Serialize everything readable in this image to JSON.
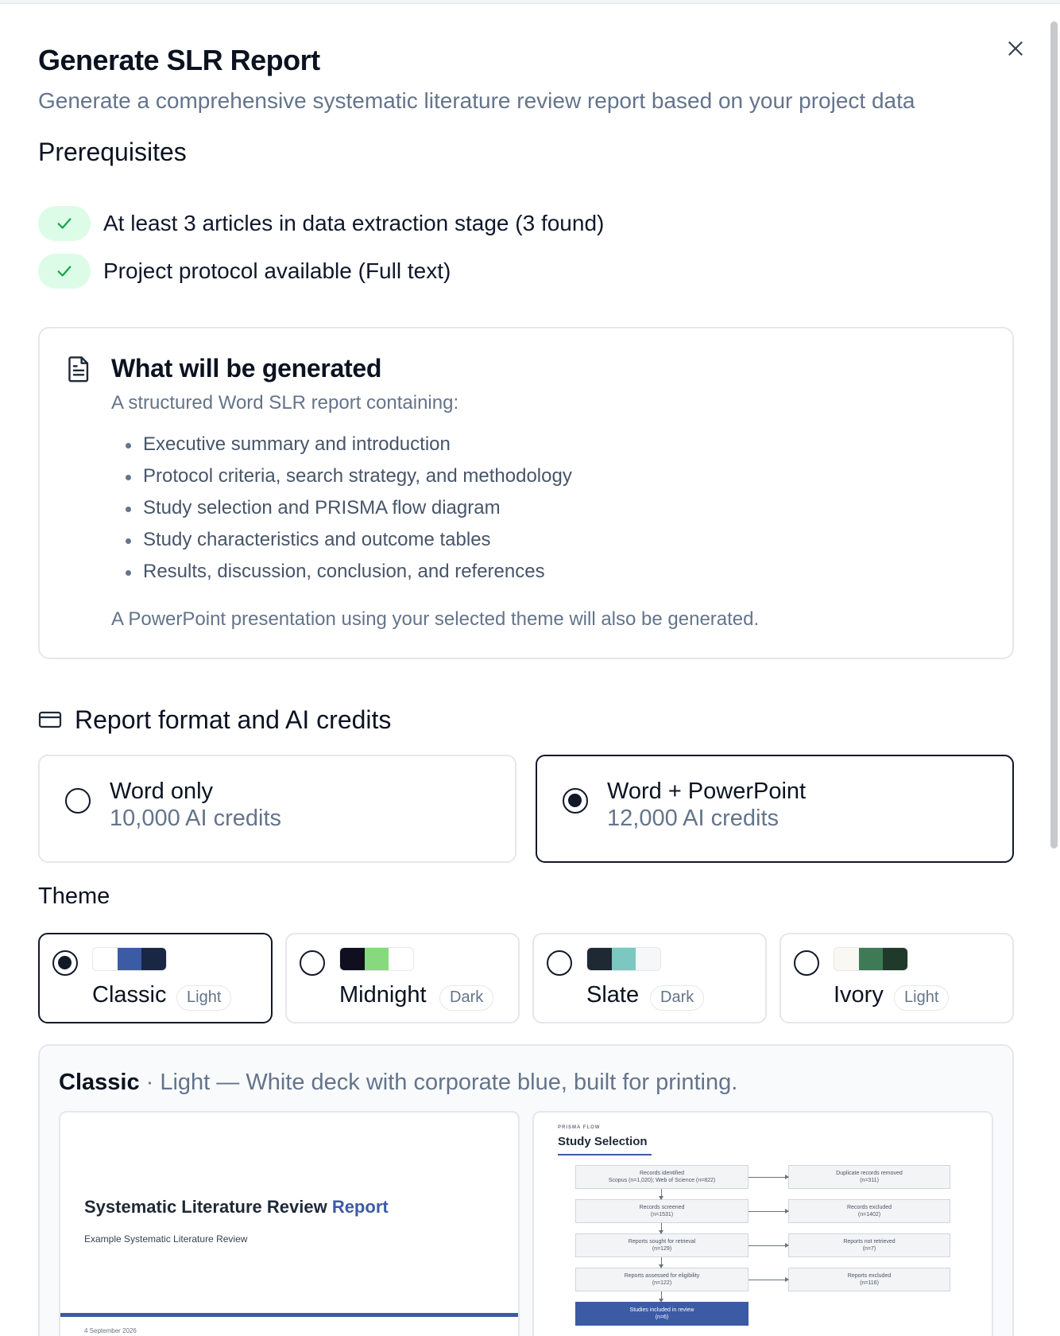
{
  "dialog": {
    "title": "Generate SLR Report",
    "subtitle": "Generate a comprehensive systematic literature review report based on your project data"
  },
  "prerequisites": {
    "heading": "Prerequisites",
    "items": [
      {
        "text": "At least 3 articles in data extraction stage (3 found)",
        "status": "met"
      },
      {
        "text": "Project protocol available (Full text)",
        "status": "met"
      }
    ]
  },
  "generated": {
    "title": "What will be generated",
    "subtitle": "A structured Word SLR report containing:",
    "items": [
      "Executive summary and introduction",
      "Protocol criteria, search strategy, and methodology",
      "Study selection and PRISMA flow diagram",
      "Study characteristics and outcome tables",
      "Results, discussion, conclusion, and references"
    ],
    "footer": "A PowerPoint presentation using your selected theme will also be generated."
  },
  "format": {
    "heading": "Report format and AI credits",
    "options": [
      {
        "name": "Word only",
        "credits": "10,000 AI credits",
        "selected": false
      },
      {
        "name": "Word + PowerPoint",
        "credits": "12,000 AI credits",
        "selected": true
      }
    ]
  },
  "theme": {
    "label": "Theme",
    "options": [
      {
        "name": "Classic",
        "mode": "Light",
        "selected": true,
        "swatch": [
          "#ffffff",
          "#3b5ba5",
          "#1a2744"
        ]
      },
      {
        "name": "Midnight",
        "mode": "Dark",
        "selected": false,
        "swatch": [
          "#0f0f1f",
          "#86d97c",
          "#ffffff"
        ]
      },
      {
        "name": "Slate",
        "mode": "Dark",
        "selected": false,
        "swatch": [
          "#1f2933",
          "#7cc8c1",
          "#f5f7f9"
        ]
      },
      {
        "name": "Ivory",
        "mode": "Light",
        "selected": false,
        "swatch": [
          "#faf8f2",
          "#3e7a55",
          "#1f3a2a"
        ]
      }
    ]
  },
  "preview": {
    "theme_name": "Classic",
    "caption_rest": " · Light — White deck with corporate blue, built for printing.",
    "slide1": {
      "title_main": "Systematic Literature Review ",
      "title_accent": "Report",
      "subtitle": "Example Systematic Literature Review",
      "date": "4 September 2026"
    },
    "slide2": {
      "kicker": "PRISMA FLOW",
      "title": "Study Selection",
      "left_boxes": [
        {
          "l1": "Records identified",
          "l2": "Scopus (n=1,020); Web of Science (n=822)"
        },
        {
          "l1": "Records screened",
          "l2": "(n=1531)"
        },
        {
          "l1": "Reports sought for retrieval",
          "l2": "(n=129)"
        },
        {
          "l1": "Reports assessed for eligibility",
          "l2": "(n=122)"
        },
        {
          "l1": "Studies included in review",
          "l2": "(n=6)"
        }
      ],
      "right_boxes": [
        {
          "l1": "Duplicate records removed",
          "l2": "(n=311)"
        },
        {
          "l1": "Records excluded",
          "l2": "(n=1402)"
        },
        {
          "l1": "Reports not retrieved",
          "l2": "(n=7)"
        },
        {
          "l1": "Reports excluded",
          "l2": "(n=116)"
        }
      ]
    }
  },
  "colors": {
    "accent": "#3b5ba5",
    "check_bg": "#dcfce7",
    "check_fg": "#16a34a",
    "muted_text": "#64748b"
  }
}
